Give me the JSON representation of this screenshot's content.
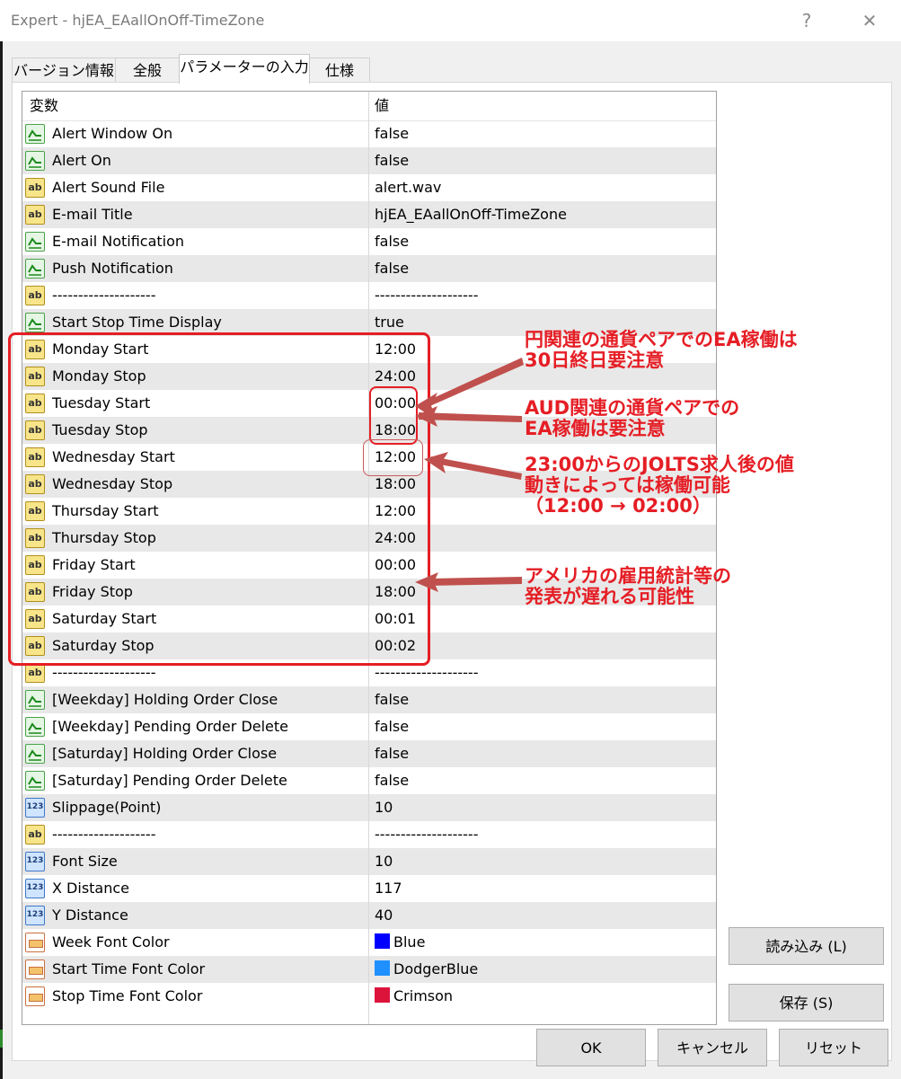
{
  "window": {
    "title": "Expert - hjEA_EAallOnOff-TimeZone",
    "help_glyph": "?",
    "close_glyph": "✕"
  },
  "tabs": [
    {
      "label": "バージョン情報"
    },
    {
      "label": "全般"
    },
    {
      "label": "パラメーターの入力"
    },
    {
      "label": "仕様"
    }
  ],
  "active_tab": 2,
  "grid": {
    "headers": {
      "variable": "変数",
      "value": "値"
    },
    "rows": [
      {
        "type": "bool",
        "name": "Alert Window On",
        "value": "false"
      },
      {
        "type": "bool",
        "name": "Alert On",
        "value": "false"
      },
      {
        "type": "string",
        "name": "Alert Sound File",
        "value": "alert.wav"
      },
      {
        "type": "string",
        "name": "E-mail Title",
        "value": "hjEA_EAallOnOff-TimeZone"
      },
      {
        "type": "bool",
        "name": "E-mail Notification",
        "value": "false"
      },
      {
        "type": "bool",
        "name": "Push Notification",
        "value": "false"
      },
      {
        "type": "string",
        "name": "--------------------",
        "value": "--------------------"
      },
      {
        "type": "bool",
        "name": "Start Stop Time Display",
        "value": "true"
      },
      {
        "type": "string",
        "name": "Monday Start",
        "value": "12:00"
      },
      {
        "type": "string",
        "name": "Monday Stop",
        "value": "24:00"
      },
      {
        "type": "string",
        "name": "Tuesday Start",
        "value": "00:00"
      },
      {
        "type": "string",
        "name": "Tuesday Stop",
        "value": "18:00"
      },
      {
        "type": "string",
        "name": "Wednesday Start",
        "value": "12:00"
      },
      {
        "type": "string",
        "name": "Wednesday Stop",
        "value": "18:00"
      },
      {
        "type": "string",
        "name": "Thursday Start",
        "value": "12:00"
      },
      {
        "type": "string",
        "name": "Thursday Stop",
        "value": "24:00"
      },
      {
        "type": "string",
        "name": "Friday Start",
        "value": "00:00"
      },
      {
        "type": "string",
        "name": "Friday Stop",
        "value": "18:00"
      },
      {
        "type": "string",
        "name": "Saturday Start",
        "value": "00:01"
      },
      {
        "type": "string",
        "name": "Saturday Stop",
        "value": "00:02"
      },
      {
        "type": "string",
        "name": "--------------------",
        "value": "--------------------"
      },
      {
        "type": "bool",
        "name": "[Weekday]  Holding Order Close",
        "value": "false"
      },
      {
        "type": "bool",
        "name": "[Weekday]  Pending Order Delete",
        "value": "false"
      },
      {
        "type": "bool",
        "name": "[Saturday]   Holding Order Close",
        "value": "false"
      },
      {
        "type": "bool",
        "name": "[Saturday]   Pending Order Delete",
        "value": "false"
      },
      {
        "type": "int",
        "name": "Slippage(Point)",
        "value": "10"
      },
      {
        "type": "string",
        "name": "--------------------",
        "value": "--------------------"
      },
      {
        "type": "int",
        "name": "Font Size",
        "value": "10"
      },
      {
        "type": "int",
        "name": "X Distance",
        "value": "117"
      },
      {
        "type": "int",
        "name": "Y Distance",
        "value": "40"
      },
      {
        "type": "color",
        "name": "Week Font Color",
        "value": "Blue",
        "swatch": "#0000ff"
      },
      {
        "type": "color",
        "name": "Start Time Font Color",
        "value": "DodgerBlue",
        "swatch": "#1e90ff"
      },
      {
        "type": "color",
        "name": "Stop Time Font Color",
        "value": "Crimson",
        "swatch": "#dc143c"
      }
    ]
  },
  "buttons": {
    "load": "読み込み (L)",
    "save": "保存 (S)",
    "ok": "OK",
    "cancel": "キャンセル",
    "reset": "リセット"
  },
  "annotations": [
    {
      "lines": [
        "円関連の通貨ペアでのEA稼働は",
        "30日終日要注意"
      ]
    },
    {
      "lines": [
        "AUD関連の通貨ペアでの",
        "EA稼働は要注意"
      ]
    },
    {
      "lines": [
        "23:00からのJOLTS求人後の値",
        "動きによっては稼働可能",
        "（12:00 → 02:00）"
      ]
    },
    {
      "lines": [
        "アメリカの雇用統計等の",
        "発表が遅れる可能性"
      ]
    }
  ],
  "accent_color": "#e51e25"
}
